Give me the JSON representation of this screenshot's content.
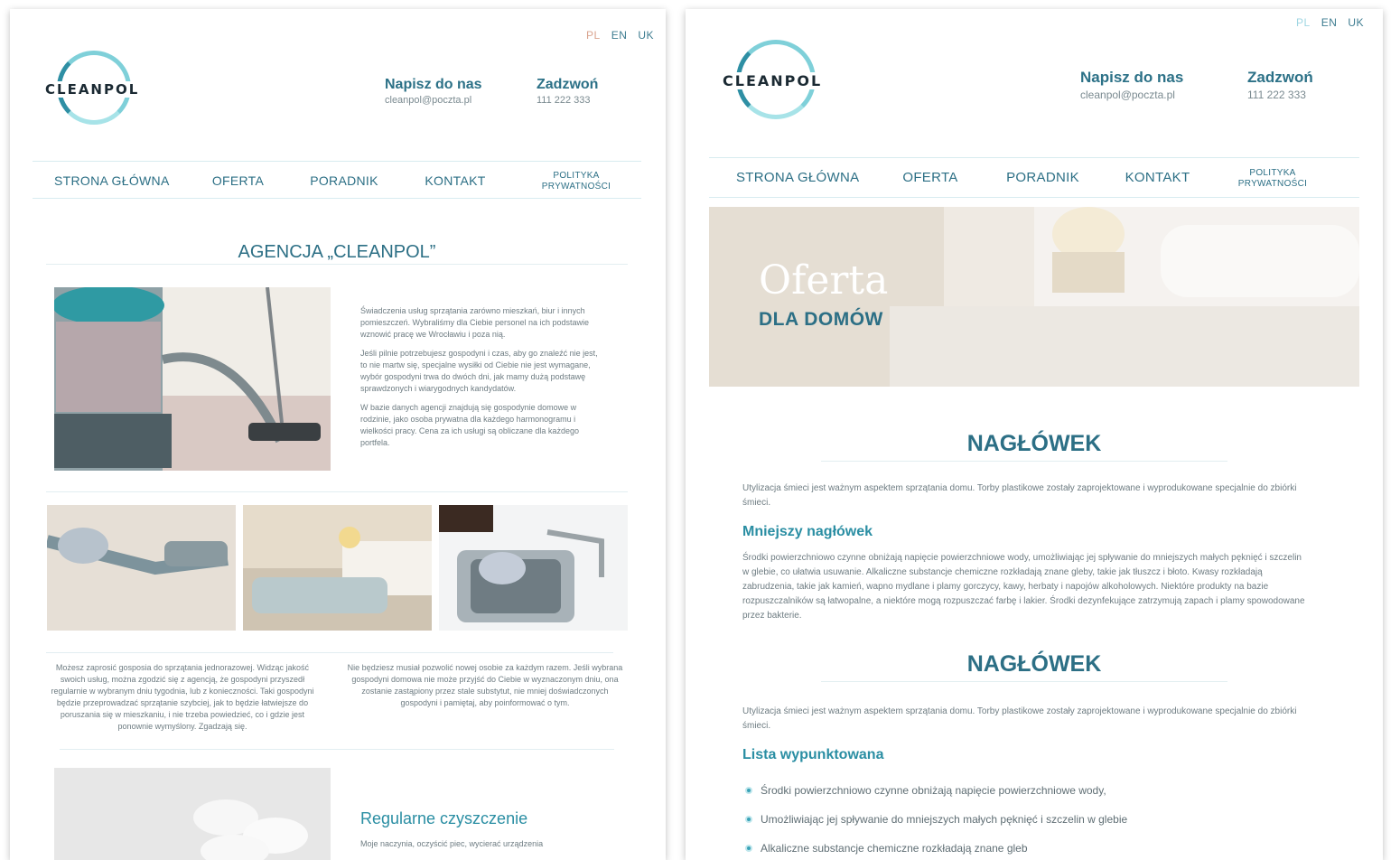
{
  "left": {
    "lang": [
      "PL",
      "EN",
      "UK"
    ],
    "logo": "CLEANPOL",
    "contact1": {
      "title": "Napisz do nas",
      "value": "cleanpol@poczta.pl"
    },
    "contact2": {
      "title": "Zadzwoń",
      "value": "111 222 333"
    },
    "nav": [
      "STRONA GŁÓWNA",
      "OFERTA",
      "PORADNIK",
      "KONTAKT",
      "POLITYKA PRYWATNOŚCI"
    ],
    "heading": "AGENCJA „CLEANPOL”",
    "intro": [
      "Świadczenia usług sprzątania zarówno mieszkań, biur i innych pomieszczeń. Wybraliśmy dla Ciebie personel na ich podstawie wznowić pracę we Wrocławiu i poza nią.",
      "Jeśli pilnie potrzebujesz gospodyni i czas, aby go znaleźć nie jest, to nie martw się, specjalne wysiłki od Ciebie nie jest wymagane, wybór gospodyni trwa do dwóch dni, jak mamy dużą podstawę sprawdzonych i wiarygodnych kandydatów.",
      "W bazie danych agencji znajdują się gospodynie domowe w rodzinie, jako osoba prywatna dla każdego harmonogramu i wielkości pracy. Cena za ich usługi są obliczane dla każdego portfela."
    ],
    "col1": "Możesz zaprosić gosposia do sprzątania jednorazowej. Widząc jakość swoich usług, można zgodzić się z agencją, że gospodyni przyszedł regularnie w wybranym dniu tygodnia, lub z konieczności. Taki gospodyni będzie przeprowadzać sprzątanie szybciej, jak to będzie łatwiejsze do poruszania się w mieszkaniu, i nie trzeba powiedzieć, co i gdzie jest ponownie wymyślony. Zgadzają się.",
    "col2": "Nie będziesz musiał pozwolić nowej osobie za każdym razem. Jeśli wybrana gospodyni domowa nie może przyjść do Ciebie w wyznaczonym dniu, ona zostanie zastąpiony przez stale substytut, nie mniej doświadczonych gospodyni i pamiętaj, aby poinformować o tym.",
    "regular_title": "Regularne czyszczenie",
    "regular_text": "Moje naczynia, oczyścić piec, wycierać urządzenia"
  },
  "right": {
    "lang": [
      "PL",
      "EN",
      "UK"
    ],
    "logo": "CLEANPOL",
    "contact1": {
      "title": "Napisz do nas",
      "value": "cleanpol@poczta.pl"
    },
    "contact2": {
      "title": "Zadzwoń",
      "value": "111 222 333"
    },
    "nav": [
      "STRONA GŁÓWNA",
      "OFERTA",
      "PORADNIK",
      "KONTAKT",
      "POLITYKA PRYWATNOŚCI"
    ],
    "hero_title": "Oferta",
    "hero_sub": "DLA DOMÓW",
    "h1": "NAGŁÓWEK",
    "p1": "Utylizacja śmieci jest ważnym aspektem sprzątania domu. Torby plastikowe zostały zaprojektowane i wyprodukowane specjalnie do zbiórki śmieci.",
    "small_heading": "Mniejszy nagłówek",
    "p2": "Środki powierzchniowo czynne obniżają napięcie powierzchniowe wody, umożliwiając jej spływanie do mniejszych małych pęknięć i szczelin w glebie, co ułatwia usuwanie. Alkaliczne substancje chemiczne rozkładają znane gleby, takie jak tłuszcz i błoto. Kwasy rozkładają zabrudzenia, takie jak kamień, wapno mydlane i plamy gorczycy, kawy, herbaty i napojów alkoholowych. Niektóre produkty na bazie rozpuszczalników są łatwopalne, a niektóre mogą rozpuszczać farbę i lakier. Środki dezynfekujące zatrzymują zapach i plamy spowodowane przez bakterie.",
    "h2": "NAGŁÓWEK",
    "p3": "Utylizacja śmieci jest ważnym aspektem sprzątania domu. Torby plastikowe zostały zaprojektowane i wyprodukowane specjalnie do zbiórki śmieci.",
    "list_heading": "Lista wypunktowana",
    "list": [
      "Środki powierzchniowo czynne obniżają napięcie powierzchniowe wody,",
      "Umożliwiając jej spływanie do mniejszych małych pęknięć i szczelin w glebie",
      "Alkaliczne substancje chemiczne rozkładają znane gleb"
    ]
  }
}
